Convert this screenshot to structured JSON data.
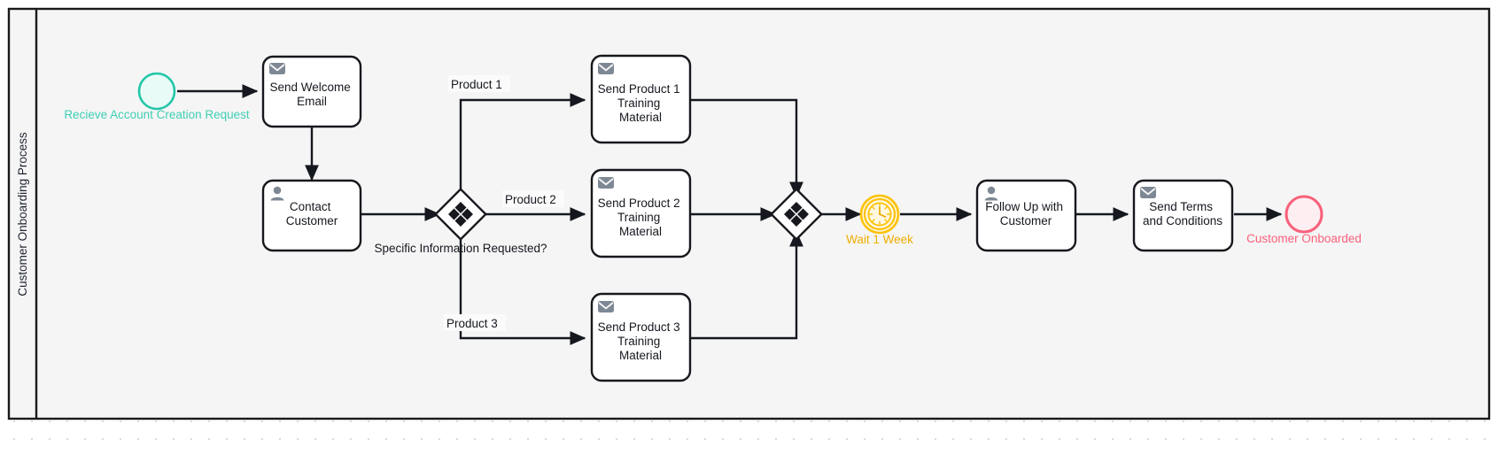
{
  "pool": {
    "lane_label": "Customer Onboarding Process"
  },
  "events": {
    "start": {
      "label": "Recieve Account Creation Request",
      "type": "start-event",
      "stroke": "#22c6a8",
      "fill": "#e8fbf7"
    },
    "timer": {
      "label": "Wait 1 Week",
      "type": "timer-intermediate-event",
      "stroke": "#ffc107",
      "fill": "#fff8e1"
    },
    "end": {
      "label": "Customer Onboarded",
      "type": "end-event",
      "stroke": "#f9617b",
      "fill": "#fdeef1"
    }
  },
  "tasks": [
    {
      "id": "send-welcome-email",
      "label": "Send Welcome Email",
      "icon": "envelope-icon"
    },
    {
      "id": "contact-customer",
      "label": "Contact Customer",
      "icon": "user-icon"
    },
    {
      "id": "send-product-1",
      "label": "Send Product 1 Training Material",
      "icon": "envelope-icon"
    },
    {
      "id": "send-product-2",
      "label": "Send Product 2 Training Material",
      "icon": "envelope-icon"
    },
    {
      "id": "send-product-3",
      "label": "Send Product 3 Training Material",
      "icon": "envelope-icon"
    },
    {
      "id": "follow-up-customer",
      "label": "Follow Up with Customer",
      "icon": "user-icon"
    },
    {
      "id": "send-terms",
      "label": "Send Terms and Conditions",
      "icon": "envelope-icon"
    }
  ],
  "task_lines": {
    "send-welcome-email": [
      "Send Welcome",
      "Email"
    ],
    "contact-customer": [
      "Contact",
      "Customer"
    ],
    "send-product-1": [
      "Send Product 1",
      "Training",
      "Material"
    ],
    "send-product-2": [
      "Send Product 2",
      "Training",
      "Material"
    ],
    "send-product-3": [
      "Send Product 3",
      "Training",
      "Material"
    ],
    "follow-up-customer": [
      "Follow Up with",
      "Customer"
    ],
    "send-terms": [
      "Send Terms",
      "and Conditions"
    ]
  },
  "gateways": {
    "split": {
      "label": "Specific Information Requested?",
      "type": "complex-gateway"
    },
    "join": {
      "label": "",
      "type": "complex-gateway"
    }
  },
  "flow_labels": {
    "product1": "Product 1",
    "product2": "Product 2",
    "product3": "Product 3"
  },
  "colors": {
    "pool_fill": "#f5f5f5",
    "pool_stroke": "#1a1a1a",
    "task_fill": "#ffffff",
    "task_stroke": "#16181d",
    "icon_gray": "#7e8895",
    "flow_stroke": "#15181f"
  }
}
